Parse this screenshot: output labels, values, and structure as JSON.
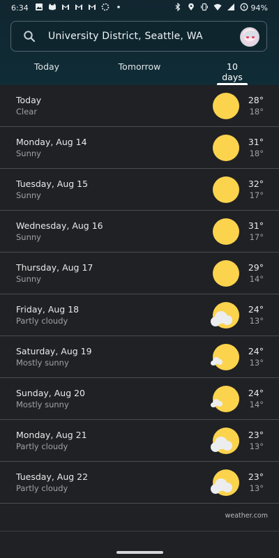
{
  "status_bar": {
    "time": "6:34",
    "battery": "94%",
    "left_icons": [
      "image-icon",
      "cat-icon",
      "gmail-icon",
      "gmail-icon",
      "gmail-icon",
      "loading-icon",
      "dot-icon"
    ],
    "right_icons": [
      "bluetooth-icon",
      "location-icon",
      "vibrate-icon",
      "wifi-icon",
      "signal-icon",
      "battery-icon"
    ]
  },
  "search": {
    "location": "University District, Seattle, WA"
  },
  "tabs": [
    {
      "label": "Today"
    },
    {
      "label": "Tomorrow"
    },
    {
      "label": "10 days"
    }
  ],
  "forecast": [
    {
      "date": "Today",
      "condition": "Clear",
      "high": "28°",
      "low": "18°",
      "icon": "sun"
    },
    {
      "date": "Monday, Aug 14",
      "condition": "Sunny",
      "high": "31°",
      "low": "18°",
      "icon": "sun"
    },
    {
      "date": "Tuesday, Aug 15",
      "condition": "Sunny",
      "high": "32°",
      "low": "17°",
      "icon": "sun"
    },
    {
      "date": "Wednesday, Aug 16",
      "condition": "Sunny",
      "high": "31°",
      "low": "17°",
      "icon": "sun"
    },
    {
      "date": "Thursday, Aug 17",
      "condition": "Sunny",
      "high": "29°",
      "low": "14°",
      "icon": "sun"
    },
    {
      "date": "Friday, Aug 18",
      "condition": "Partly cloudy",
      "high": "24°",
      "low": "13°",
      "icon": "partly-cloudy"
    },
    {
      "date": "Saturday, Aug 19",
      "condition": "Mostly sunny",
      "high": "24°",
      "low": "13°",
      "icon": "mostly-sunny"
    },
    {
      "date": "Sunday, Aug 20",
      "condition": "Mostly sunny",
      "high": "24°",
      "low": "14°",
      "icon": "mostly-sunny"
    },
    {
      "date": "Monday, Aug 21",
      "condition": "Partly cloudy",
      "high": "23°",
      "low": "13°",
      "icon": "partly-cloudy"
    },
    {
      "date": "Tuesday, Aug 22",
      "condition": "Partly cloudy",
      "high": "23°",
      "low": "13°",
      "icon": "partly-cloudy"
    }
  ],
  "credit": "weather.com",
  "colors": {
    "header_bg": "#0f2c37",
    "list_bg": "#202124",
    "sun": "#fcd34d",
    "cloud": "#ebedef"
  }
}
